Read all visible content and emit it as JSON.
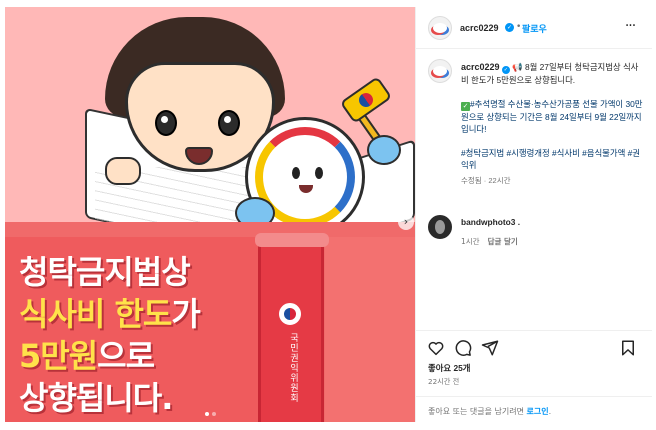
{
  "post": {
    "headline_line1": "청탁금지법상",
    "headline_line2_highlight": "식사비 한도",
    "headline_line2_rest": "가",
    "headline_line3_highlight": "5만원",
    "headline_line3_rest": "으로",
    "headline_line4": "상향됩니다.",
    "spine_text": "국민권익위원회",
    "carousel_next_glyph": "›",
    "carousel": {
      "count": 2,
      "active": 0
    }
  },
  "header": {
    "username": "acrc0229",
    "verified_glyph": "✓",
    "separator": "•",
    "follow_label": "팔로우",
    "more_glyph": "···"
  },
  "caption": {
    "username": "acrc0229",
    "verified_glyph": "✓",
    "line1": " 📢 8월 27일부터 청탁금지법상 식사비 한도가 5만원으로 상향됩니다.",
    "check_glyph": "✓",
    "line2": "#추석명절 수산물·농수산가공품 선물 가액이 30만원으로 상향되는 기간은 8월 24일부터 9월 22일까지입니다!",
    "hashtags": "#청탁금지법 #시행령개정 #식사비 #음식물가액 #권익위",
    "meta": "수정됨 · 22시간"
  },
  "comment": {
    "username": "bandwphoto3 .",
    "time": "1시간",
    "reply_label": "답글 달기"
  },
  "actions": {
    "like_icon": "heart-icon",
    "comment_icon": "comment-icon",
    "share_icon": "share-icon",
    "save_icon": "bookmark-icon"
  },
  "likes": "좋아요 25개",
  "post_time": "22시간 전",
  "login_prompt": {
    "text": "좋아요 또는 댓글을 남기려면 ",
    "link": "로그인",
    "suffix": "."
  }
}
